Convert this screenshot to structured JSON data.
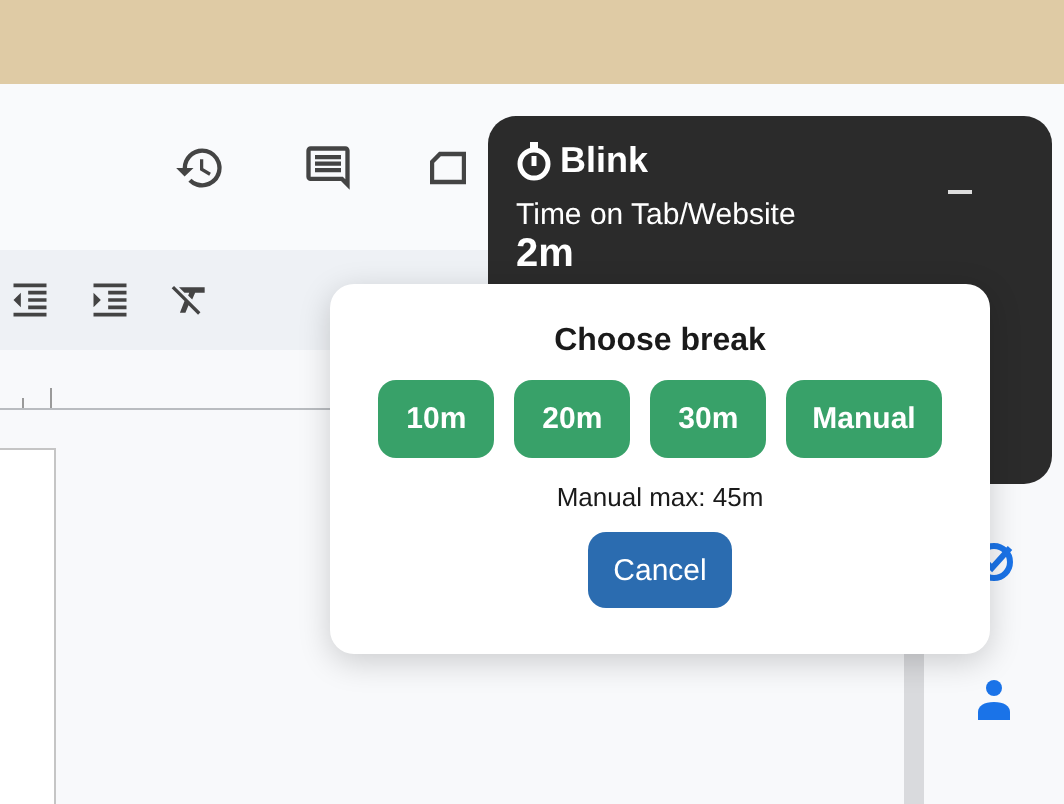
{
  "blink_panel": {
    "title": "Blink",
    "label": "Time on Tab/Website",
    "time": "2m"
  },
  "break_dialog": {
    "title": "Choose break",
    "options": [
      {
        "label": "10m"
      },
      {
        "label": "20m"
      },
      {
        "label": "30m"
      },
      {
        "label": "Manual"
      }
    ],
    "note": "Manual max: 45m",
    "cancel": "Cancel"
  }
}
